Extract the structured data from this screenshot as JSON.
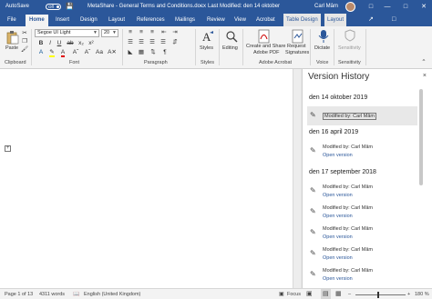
{
  "titlebar": {
    "autosave_label": "AutoSave",
    "autosave_state": "Off",
    "document_title": "MetaShare - General Terms and Conditions.docx",
    "separator": "-",
    "last_modified": "Last Modified: den 14 oktober",
    "user_name": "Carl Mâm",
    "accent_color": "#2b579a"
  },
  "tabs": [
    {
      "label": "File"
    },
    {
      "label": "Home"
    },
    {
      "label": "Insert"
    },
    {
      "label": "Design"
    },
    {
      "label": "Layout"
    },
    {
      "label": "References"
    },
    {
      "label": "Mailings"
    },
    {
      "label": "Review"
    },
    {
      "label": "View"
    },
    {
      "label": "Acrobat"
    },
    {
      "label": "Table Design"
    },
    {
      "label": "Layout"
    }
  ],
  "ribbon": {
    "clipboard": {
      "paste_label": "Paste",
      "group_label": "Clipboard"
    },
    "font": {
      "font_name": "Segoe UI Light",
      "font_size": "20",
      "group_label": "Font"
    },
    "paragraph": {
      "group_label": "Paragraph"
    },
    "styles": {
      "styles_label": "Styles",
      "group_label": "Styles"
    },
    "editing": {
      "editing_label": "Editing"
    },
    "acrobat": {
      "create_share_label_1": "Create and Share",
      "create_share_label_2": "Adobe PDF",
      "request_sig_label_1": "Request",
      "request_sig_label_2": "Signatures",
      "group_label": "Adobe Acrobat"
    },
    "voice": {
      "dictate_label": "Dictate",
      "group_label": "Voice"
    },
    "sensitivity": {
      "sensitivity_label": "Sensitivity",
      "group_label": "Sensitivity"
    }
  },
  "version_history": {
    "title": "Version History",
    "close_icon": "×",
    "groups": [
      {
        "date": "den 14 oktober 2019",
        "items": [
          {
            "modified_by": "Modified by: Carl Mâm",
            "open": ""
          }
        ]
      },
      {
        "date": "den 16 april 2019",
        "items": [
          {
            "modified_by": "Modified by: Carl Mâm",
            "open": "Open version"
          }
        ]
      },
      {
        "date": "den 17 september 2018",
        "items": [
          {
            "modified_by": "Modified by: Carl Mâm",
            "open": "Open version"
          },
          {
            "modified_by": "Modified by: Carl Mâm",
            "open": "Open version"
          },
          {
            "modified_by": "Modified by: Carl Mâm",
            "open": "Open version"
          },
          {
            "modified_by": "Modified by: Carl Mâm",
            "open": "Open version"
          },
          {
            "modified_by": "Modified by: Carl Mâm",
            "open": "Open version"
          }
        ]
      }
    ]
  },
  "statusbar": {
    "page": "Page 1 of 13",
    "words": "4311 words",
    "language": "English (United Kingdom)",
    "focus": "Focus",
    "zoom": "180 %"
  }
}
